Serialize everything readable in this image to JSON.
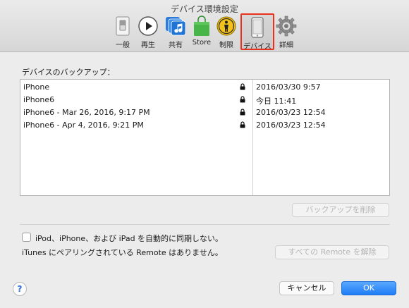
{
  "window": {
    "title": "デバイス環境設定"
  },
  "toolbar": {
    "items": [
      {
        "label": "一般",
        "icon": "general-switch-icon"
      },
      {
        "label": "再生",
        "icon": "play-icon"
      },
      {
        "label": "共有",
        "icon": "music-sharing-icon"
      },
      {
        "label": "Store",
        "icon": "store-bag-icon"
      },
      {
        "label": "制限",
        "icon": "restrictions-icon"
      },
      {
        "label": "デバイス",
        "icon": "device-iphone-icon",
        "selected": true
      },
      {
        "label": "詳細",
        "icon": "gear-icon"
      }
    ]
  },
  "backups": {
    "label": "デバイスのバックアップ：",
    "rows": [
      {
        "name": "iPhone",
        "date": "2016/03/30 9:57",
        "locked": true
      },
      {
        "name": "iPhone6",
        "date": "今日 11:41",
        "locked": true
      },
      {
        "name": "iPhone6 - Mar 26, 2016, 9:17 PM",
        "date": "2016/03/23 12:54",
        "locked": true
      },
      {
        "name": "iPhone6 - Apr 4, 2016, 9:21 PM",
        "date": "2016/03/23 12:54",
        "locked": true
      }
    ],
    "delete_button": "バックアップを削除"
  },
  "sync": {
    "checkbox_label": "iPod、iPhone、および iPad を自動的に同期しない。",
    "checked": false
  },
  "remote": {
    "text": "iTunes にペアリングされている Remote はありません。",
    "unpair_button": "すべての Remote を解除"
  },
  "footer": {
    "help": "?",
    "cancel": "キャンセル",
    "ok": "OK"
  },
  "colors": {
    "selection_outline": "#e8321e",
    "primary_button": "#1e7cf5"
  }
}
